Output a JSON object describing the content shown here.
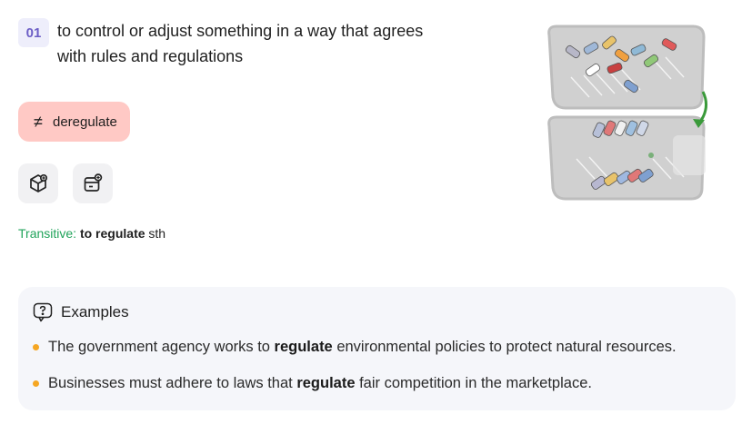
{
  "sense": {
    "number": "01",
    "definition": "to control or adjust something in a way that agrees with rules and regulations"
  },
  "antonym": {
    "symbol": "≠",
    "word": "deregulate",
    "color": "#ffc9c5"
  },
  "actions": [
    {
      "icon": "cube-add-icon"
    },
    {
      "icon": "card-add-icon"
    }
  ],
  "grammar": {
    "type": "Transitive:",
    "verb": "to regulate",
    "object": "sth"
  },
  "examples": {
    "heading": "Examples",
    "items": [
      {
        "before": "The government agency works to ",
        "keyword": "regulate",
        "after": " environmental policies to protect natural resources."
      },
      {
        "before": "Businesses must adhere to laws that ",
        "keyword": "regulate",
        "after": " fair competition in the marketplace."
      }
    ]
  },
  "colors": {
    "accent": "#6c5ec6",
    "grammar_type": "#20a35a",
    "bullet": "#f5a623",
    "arrow": "#3a9a3a"
  }
}
